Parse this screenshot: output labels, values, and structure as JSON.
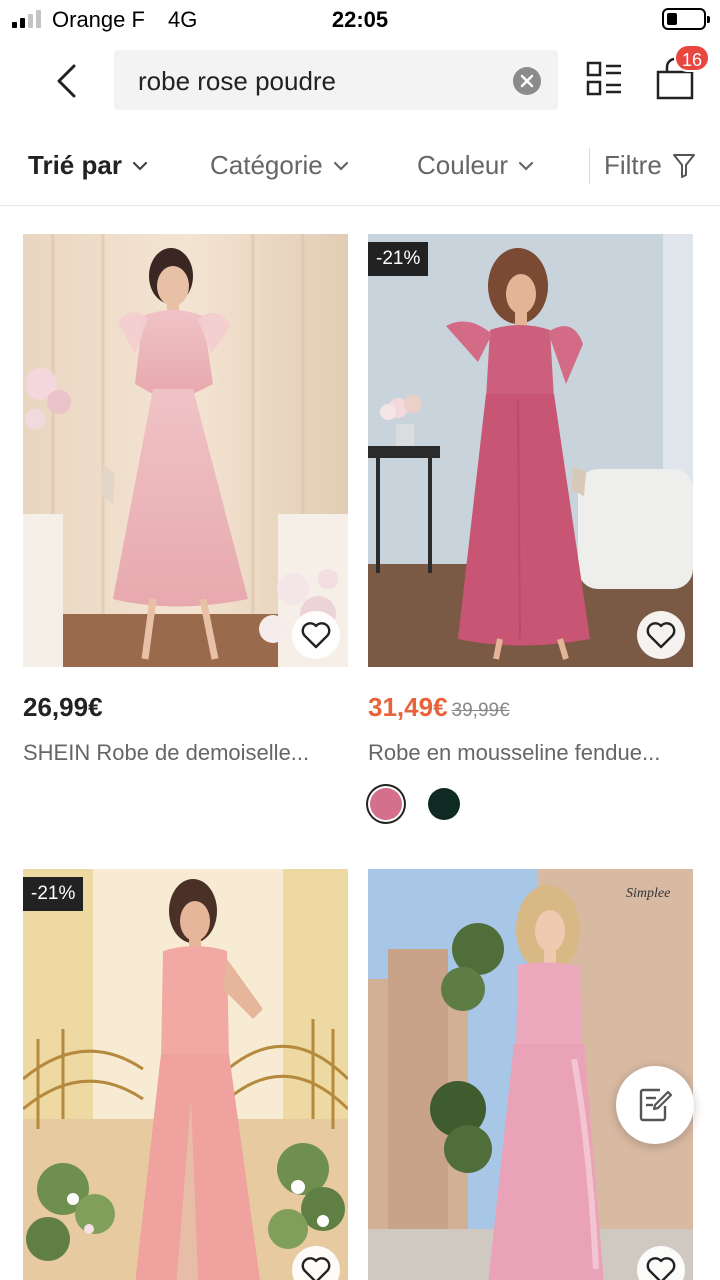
{
  "status_bar": {
    "carrier": "Orange F",
    "network": "4G",
    "time": "22:05",
    "signal_bars": 4,
    "signal_strength": 2,
    "battery_level": 0.2
  },
  "search": {
    "query": "robe rose poudre",
    "back_icon": "chevron-left-icon",
    "clear_icon": "clear-icon"
  },
  "header": {
    "grid_icon": "grid-list-icon",
    "bag_icon": "shopping-bag-icon",
    "bag_count": "16"
  },
  "filters": {
    "sort_label": "Trié par",
    "category_label": "Catégorie",
    "color_label": "Couleur",
    "filter_label": "Filtre"
  },
  "products": [
    {
      "price": "26,99€",
      "title": "SHEIN Robe de demoiselle...",
      "favorite_icon": "heart-icon"
    },
    {
      "discount": "-21%",
      "price": "31,49€",
      "old_price": "39,99€",
      "title": "Robe en mousseline fendue...",
      "favorite_icon": "heart-icon",
      "swatches": [
        {
          "color": "#d4708c",
          "selected": true
        },
        {
          "color": "#0f2a22",
          "selected": false
        }
      ]
    },
    {
      "discount": "-21%",
      "favorite_icon": "heart-icon"
    },
    {
      "brand_logo": "Simplee",
      "favorite_icon": "heart-icon"
    }
  ],
  "colors": {
    "sale_price": "#e8633a",
    "badge": "#e8473f",
    "discount_tag": "#222222"
  },
  "floating_button": {
    "icon": "write-review-icon"
  }
}
